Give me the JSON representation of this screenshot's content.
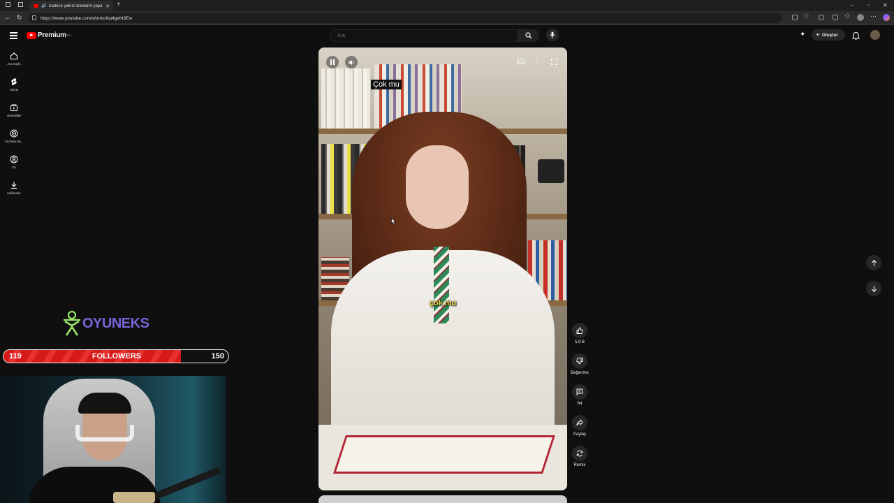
{
  "browser": {
    "tab_title": "Sadece yalnız olanların yapa",
    "url": "https://www.youtube.com/shorts/inp4gehI3Ew",
    "window_controls": [
      "minimize-icon",
      "restore-icon",
      "close-icon"
    ]
  },
  "header": {
    "logo_text": "Premium",
    "logo_superscript": "TR",
    "search_placeholder": "Ara",
    "create_label": "Oluştur"
  },
  "sidebar": {
    "items": [
      {
        "label": "Ana Sayfa",
        "icon": "home-icon"
      },
      {
        "label": "Shorts",
        "icon": "shorts-icon"
      },
      {
        "label": "Abonelikler",
        "icon": "subscriptions-icon"
      },
      {
        "label": "YouTube Mu...",
        "icon": "music-icon"
      },
      {
        "label": "Siz",
        "icon": "you-icon"
      },
      {
        "label": "İndirilenler",
        "icon": "download-icon"
      }
    ]
  },
  "video": {
    "caption_top": "Çok mu",
    "caption_mid": "çok mu"
  },
  "actions": {
    "like_count": "5,9 B",
    "dislike_label": "Beğenme",
    "comment_count": "64",
    "share_label": "Paylaş",
    "remix_label": "Remix"
  },
  "overlay": {
    "brand": "OYUNEKS",
    "followers_label": "FOLLOWERS",
    "followers_current": "119",
    "followers_goal": "150",
    "followers_progress": 0.79
  },
  "colors": {
    "background": "#0f0f0f",
    "youtube_red": "#ff0000",
    "caption_yellow": "#f3e04a",
    "follower_bar": "#d61a1a",
    "brand_purple": "#7a63d8"
  }
}
